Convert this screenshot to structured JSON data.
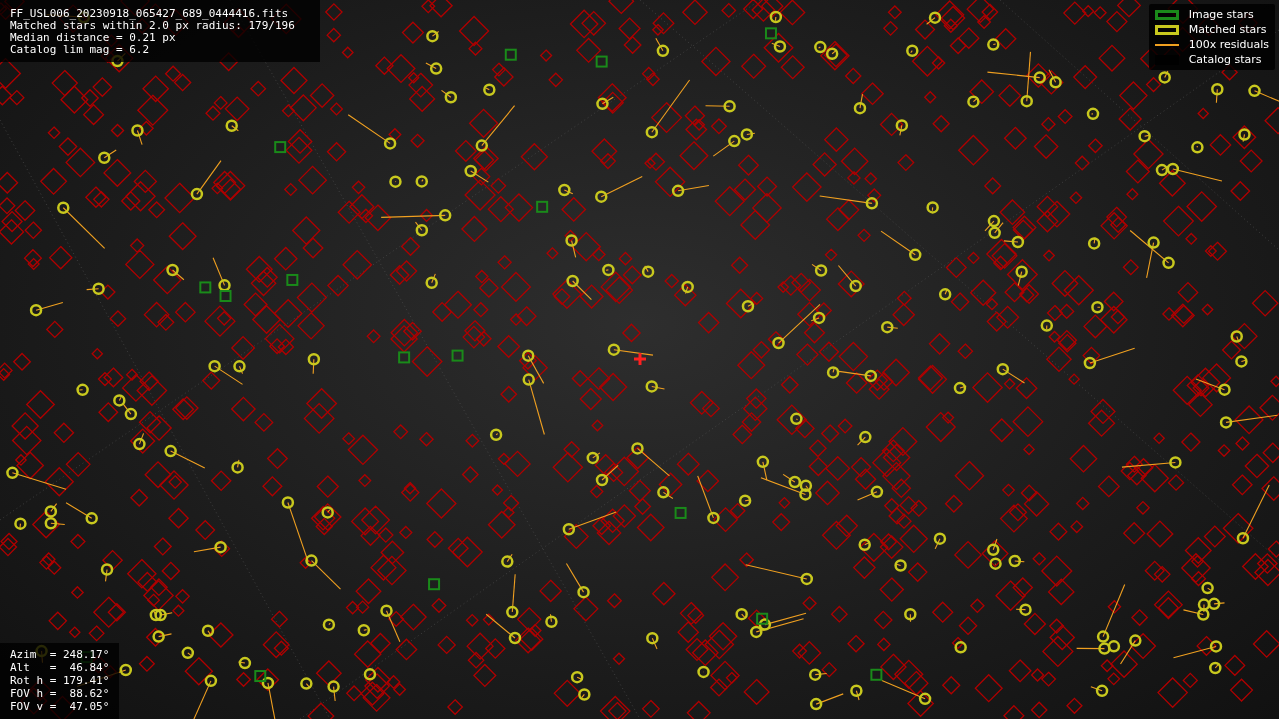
{
  "info_lines": [
    "FF_USL006_20230918_065427_689_0444416.fits",
    "Matched stars within 2.0 px radius: 179/196",
    "Median distance = 0.21 px",
    "Catalog lim mag = 6.2"
  ],
  "legend": [
    {
      "kind": "image",
      "label": "Image stars",
      "color": "#1a8a1a"
    },
    {
      "kind": "matched",
      "label": "Matched stars",
      "color": "#c8c81e"
    },
    {
      "kind": "residual",
      "label": "100x residuals",
      "color": "#f0a020"
    },
    {
      "kind": "catalog",
      "label": "Catalog stars",
      "color": "#000000"
    }
  ],
  "pointing_lines": [
    "Azim  = 248.17°",
    "Alt   =  46.84°",
    "Rot h = 179.41°",
    "FOV h =  88.62°",
    "FOV v =  47.05°"
  ]
}
